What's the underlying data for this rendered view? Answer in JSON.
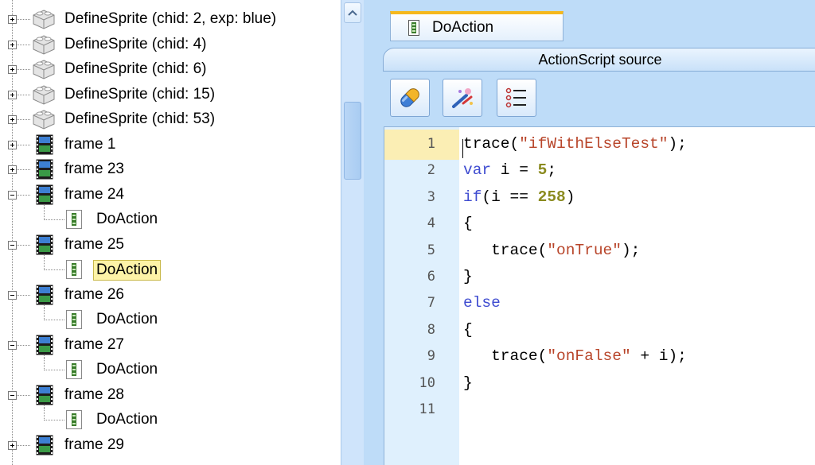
{
  "tree": {
    "items": [
      {
        "label": "DefineSprite (chid: 2, exp: blue)",
        "icon": "sprite-icon",
        "expander": "plus",
        "level": 0
      },
      {
        "label": "DefineSprite (chid: 4)",
        "icon": "sprite-icon",
        "expander": "plus",
        "level": 0
      },
      {
        "label": "DefineSprite (chid: 6)",
        "icon": "sprite-icon",
        "expander": "plus",
        "level": 0
      },
      {
        "label": "DefineSprite (chid: 15)",
        "icon": "sprite-icon",
        "expander": "plus",
        "level": 0
      },
      {
        "label": "DefineSprite (chid: 53)",
        "icon": "sprite-icon",
        "expander": "plus",
        "level": 0
      },
      {
        "label": "frame 1",
        "icon": "frame-icon",
        "expander": "plus",
        "level": 0
      },
      {
        "label": "frame 23",
        "icon": "frame-icon",
        "expander": "plus",
        "level": 0
      },
      {
        "label": "frame 24",
        "icon": "frame-icon",
        "expander": "minus",
        "level": 0
      },
      {
        "label": "DoAction",
        "icon": "doaction-icon",
        "expander": "none",
        "level": 1
      },
      {
        "label": "frame 25",
        "icon": "frame-icon",
        "expander": "minus",
        "level": 0
      },
      {
        "label": "DoAction",
        "icon": "doaction-icon",
        "expander": "none",
        "level": 1,
        "selected": true
      },
      {
        "label": "frame 26",
        "icon": "frame-icon",
        "expander": "minus",
        "level": 0
      },
      {
        "label": "DoAction",
        "icon": "doaction-icon",
        "expander": "none",
        "level": 1
      },
      {
        "label": "frame 27",
        "icon": "frame-icon",
        "expander": "minus",
        "level": 0
      },
      {
        "label": "DoAction",
        "icon": "doaction-icon",
        "expander": "none",
        "level": 1
      },
      {
        "label": "frame 28",
        "icon": "frame-icon",
        "expander": "minus",
        "level": 0
      },
      {
        "label": "DoAction",
        "icon": "doaction-icon",
        "expander": "none",
        "level": 1
      },
      {
        "label": "frame 29",
        "icon": "frame-icon",
        "expander": "plus",
        "level": 0
      }
    ]
  },
  "tab": {
    "label": "DoAction",
    "icon": "doaction-icon"
  },
  "section": {
    "title": "ActionScript source"
  },
  "toolbar": {
    "buttons": [
      {
        "name": "capsule-icon"
      },
      {
        "name": "wand-icon"
      },
      {
        "name": "list-icon"
      }
    ]
  },
  "editor": {
    "current_line": 1,
    "lines": [
      [
        {
          "t": "trace(",
          "c": ""
        },
        {
          "t": "\"ifWithElseTest\"",
          "c": "str"
        },
        {
          "t": ");",
          "c": ""
        }
      ],
      [
        {
          "t": "var",
          "c": "kw"
        },
        {
          "t": " i = ",
          "c": ""
        },
        {
          "t": "5",
          "c": "num"
        },
        {
          "t": ";",
          "c": ""
        }
      ],
      [
        {
          "t": "if",
          "c": "kw"
        },
        {
          "t": "(i == ",
          "c": ""
        },
        {
          "t": "258",
          "c": "num"
        },
        {
          "t": ")",
          "c": ""
        }
      ],
      [
        {
          "t": "{",
          "c": ""
        }
      ],
      [
        {
          "t": "   trace(",
          "c": ""
        },
        {
          "t": "\"onTrue\"",
          "c": "str"
        },
        {
          "t": ");",
          "c": ""
        }
      ],
      [
        {
          "t": "}",
          "c": ""
        }
      ],
      [
        {
          "t": "else",
          "c": "kw"
        }
      ],
      [
        {
          "t": "{",
          "c": ""
        }
      ],
      [
        {
          "t": "   trace(",
          "c": ""
        },
        {
          "t": "\"onFalse\"",
          "c": "str"
        },
        {
          "t": " + i);",
          "c": ""
        }
      ],
      [
        {
          "t": "}",
          "c": ""
        }
      ],
      []
    ],
    "line_numbers": [
      "1",
      "2",
      "3",
      "4",
      "5",
      "6",
      "7",
      "8",
      "9",
      "10",
      "11"
    ]
  },
  "colors": {
    "panel_bg": "#bedcf8",
    "gutter_bg": "#dff0fd",
    "current_line": "#fbeeb4",
    "tab_accent": "#f5b81d",
    "keyword": "#3e4bd0",
    "string": "#b8452a",
    "number": "#8a8a1e"
  }
}
